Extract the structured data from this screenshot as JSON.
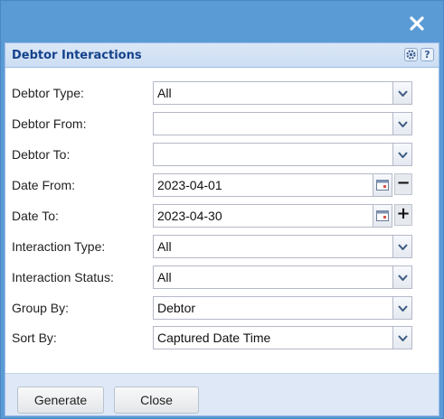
{
  "window": {
    "close_icon": "close-icon"
  },
  "panel": {
    "title": "Debtor Interactions",
    "tools": [
      "gear-icon",
      "help-icon"
    ],
    "help_glyph": "?"
  },
  "form": {
    "debtor_type": {
      "label": "Debtor Type:",
      "value": "All"
    },
    "debtor_from": {
      "label": "Debtor From:",
      "value": ""
    },
    "debtor_to": {
      "label": "Debtor To:",
      "value": ""
    },
    "date_from": {
      "label": "Date From:",
      "value": "2023-04-01",
      "step": "−"
    },
    "date_to": {
      "label": "Date To:",
      "value": "2023-04-30",
      "step": "+"
    },
    "interaction_type": {
      "label": "Interaction Type:",
      "value": "All"
    },
    "interaction_status": {
      "label": "Interaction Status:",
      "value": "All"
    },
    "group_by": {
      "label": "Group By:",
      "value": "Debtor"
    },
    "sort_by": {
      "label": "Sort By:",
      "value": "Captured Date Time"
    }
  },
  "buttons": {
    "generate": "Generate",
    "close": "Close"
  },
  "colors": {
    "window_frame": "#5b9bd5",
    "panel_title": "#15428b",
    "panel_bg": "#dfe8f6"
  }
}
